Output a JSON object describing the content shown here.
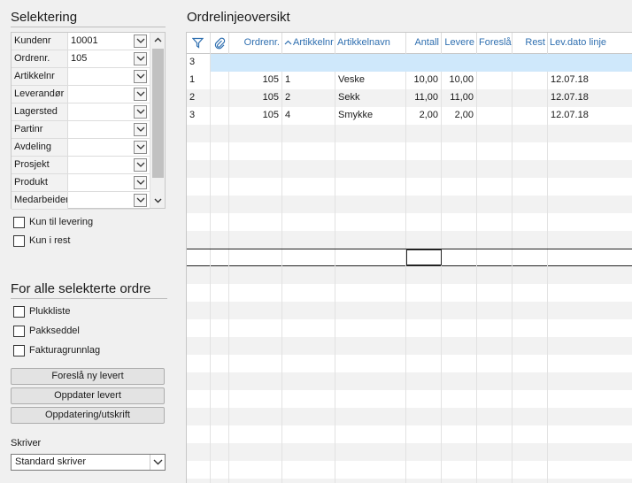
{
  "selection": {
    "title": "Selektering",
    "rows": [
      {
        "label": "Kundenr",
        "value": "10001"
      },
      {
        "label": "Ordrenr.",
        "value": "105"
      },
      {
        "label": "Artikkelnr",
        "value": ""
      },
      {
        "label": "Leverandør",
        "value": ""
      },
      {
        "label": "Lagersted",
        "value": ""
      },
      {
        "label": "Partinr",
        "value": ""
      },
      {
        "label": "Avdeling",
        "value": ""
      },
      {
        "label": "Prosjekt",
        "value": ""
      },
      {
        "label": "Produkt",
        "value": ""
      },
      {
        "label": "Medarbeider",
        "value": ""
      }
    ],
    "checkboxes": [
      {
        "label": "Kun til levering",
        "checked": false
      },
      {
        "label": "Kun i rest",
        "checked": false
      }
    ]
  },
  "orders": {
    "title": "For alle selekterte ordre",
    "checkboxes": [
      {
        "label": "Plukkliste",
        "checked": false
      },
      {
        "label": "Pakkseddel",
        "checked": false
      },
      {
        "label": "Fakturagrunnlag",
        "checked": false
      }
    ],
    "buttons": {
      "suggest": "Foreslå ny levert",
      "update": "Oppdater levert",
      "update_print": "Oppdatering/utskrift"
    },
    "printer_label": "Skriver",
    "printer_value": "Standard skriver"
  },
  "grid": {
    "title": "Ordrelinjeoversikt",
    "columns": [
      "Ordrenr.",
      "Artikkelnr",
      "Artikkelnavn",
      "Antall",
      "Levere",
      "Foreslå",
      "Rest",
      "Lev.dato linje"
    ],
    "filter_row_value": "3",
    "rows": [
      {
        "no": "1",
        "ordrenr": "105",
        "artikkelnr": "1",
        "artikkelnavn": "Veske",
        "antall": "10,00",
        "levere": "10,00",
        "foresla": "",
        "rest": "",
        "levdato": "12.07.18"
      },
      {
        "no": "2",
        "ordrenr": "105",
        "artikkelnr": "2",
        "artikkelnavn": "Sekk",
        "antall": "11,00",
        "levere": "11,00",
        "foresla": "",
        "rest": "",
        "levdato": "12.07.18"
      },
      {
        "no": "3",
        "ordrenr": "105",
        "artikkelnr": "4",
        "artikkelnavn": "Smykke",
        "antall": "2,00",
        "levere": "2,00",
        "foresla": "",
        "rest": "",
        "levdato": "12.07.18"
      }
    ]
  },
  "colors": {
    "accent": "#2f6fb0",
    "selected_row": "#cfe8fb",
    "alt_row": "#f2f2f2",
    "panel": "#f0f0f0"
  }
}
